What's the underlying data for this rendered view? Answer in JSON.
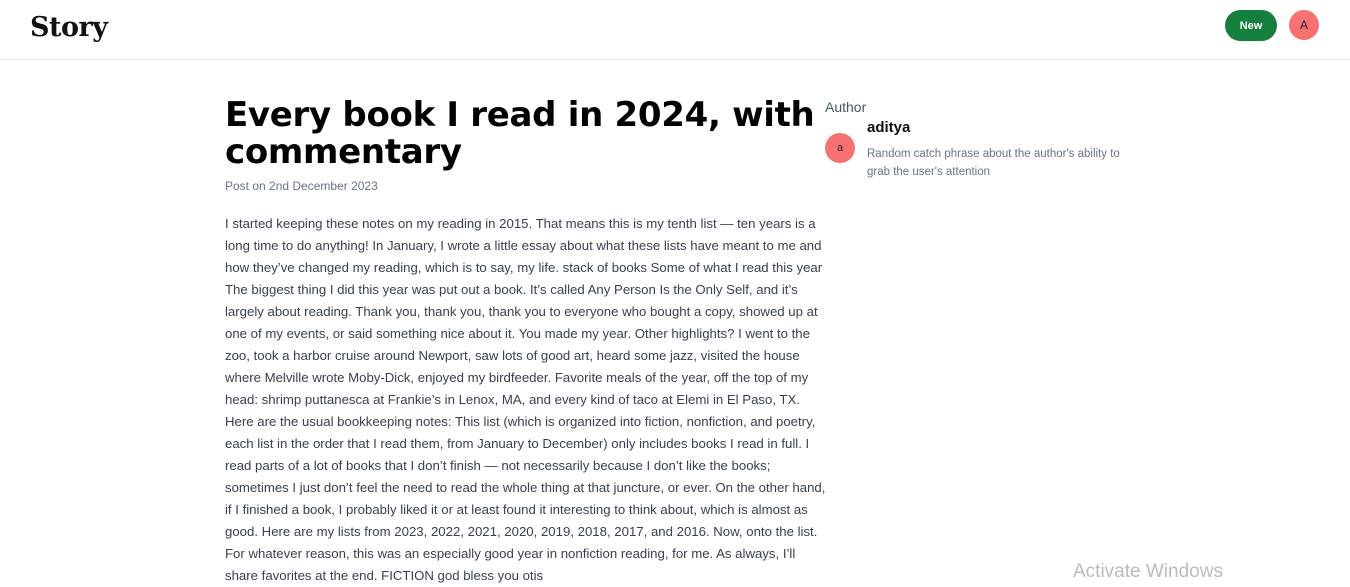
{
  "header": {
    "logo": "Story",
    "new_button": "New",
    "avatar_initial": "A"
  },
  "article": {
    "title": "Every book I read in 2024, with commentary",
    "post_date": "Post on 2nd December 2023",
    "body": "I started keeping these notes on my reading in 2015. That means this is my tenth list — ten years is a long time to do anything! In January, I wrote a little essay about what these lists have meant to me and how they’ve changed my reading, which is to say, my life. stack of books Some of what I read this year The biggest thing I did this year was put out a book. It’s called Any Person Is the Only Self, and it’s largely about reading. Thank you, thank you, thank you to everyone who bought a copy, showed up at one of my events, or said something nice about it. You made my year. Other highlights? I went to the zoo, took a harbor cruise around Newport, saw lots of good art, heard some jazz, visited the house where Melville wrote Moby-Dick, enjoyed my birdfeeder. Favorite meals of the year, off the top of my head: shrimp puttanesca at Frankie’s in Lenox, MA, and every kind of taco at Elemi in El Paso, TX. Here are the usual bookkeeping notes: This list (which is organized into fiction, nonfiction, and poetry, each list in the order that I read them, from January to December) only includes books I read in full. I read parts of a lot of books that I don’t finish — not necessarily because I don’t like the books; sometimes I just don’t feel the need to read the whole thing at that juncture, or ever. On the other hand, if I finished a book, I probably liked it or at least found it interesting to think about, which is almost as good. Here are my lists from 2023, 2022, 2021, 2020, 2019, 2018, 2017, and 2016. Now, onto the list. For whatever reason, this was an especially good year in nonfiction reading, for me. As always, I’ll share favorites at the end. FICTION god bless you otis"
  },
  "sidebar": {
    "heading": "Author",
    "author_name": "aditya",
    "author_initial": "a",
    "author_bio": "Random catch phrase about the author's ability to grab the user's attention"
  },
  "overlay": {
    "watermark": "Activate Windows"
  },
  "colors": {
    "accent_button": "#15803d",
    "avatar": "#f87171"
  }
}
